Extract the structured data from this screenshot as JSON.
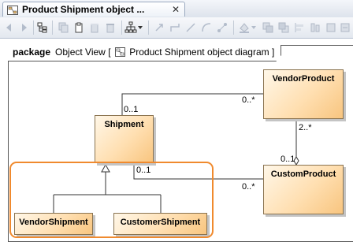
{
  "tab": {
    "title": "Product Shipment object ...",
    "close": "✕"
  },
  "toolbar": {
    "buttons": [
      "back-arrow-icon",
      "forward-arrow-icon",
      "select-in-tree-icon",
      "copy-icon",
      "paste-icon",
      "delete-icon",
      "delete-model-icon",
      "layout-icon",
      "layout-dropdown-icon",
      "path-style-icon",
      "rectilinear-path-icon",
      "oblique-path-icon",
      "bezier-path-icon",
      "fill-color-icon",
      "bring-to-front-icon",
      "send-to-back-icon",
      "align-icon"
    ]
  },
  "frame": {
    "keyword": "package",
    "name": "Object View",
    "bracket_open": "[",
    "diagram_name": "Product Shipment object diagram",
    "bracket_close": "]"
  },
  "nodes": {
    "vendor_product": "VendorProduct",
    "shipment": "Shipment",
    "custom_product": "CustomProduct",
    "vendor_shipment": "VendorShipment",
    "customer_shipment": "CustomerShipment"
  },
  "multiplicities": {
    "shipment_top": "0..1",
    "vendor_product_left": "0..*",
    "vendor_product_bottom": "2..*",
    "custom_product_top": "0..1",
    "shipment_bottom": "0..1",
    "custom_product_left": "0..*"
  },
  "colors": {
    "highlight": "#f08a2e",
    "node_border": "#8a7350"
  }
}
